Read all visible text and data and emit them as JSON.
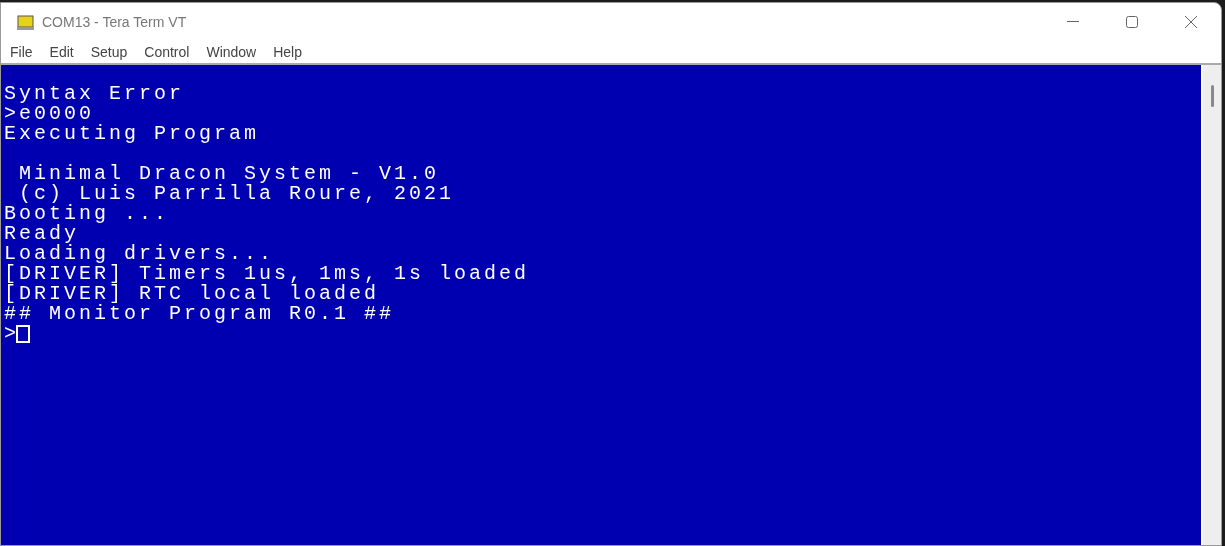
{
  "window": {
    "title": "COM13 - Tera Term VT"
  },
  "menu": [
    "File",
    "Edit",
    "Setup",
    "Control",
    "Window",
    "Help"
  ],
  "terminal": {
    "blocks": [
      [
        "Syntax Error",
        ">e0000",
        "Executing Program"
      ],
      [
        " Minimal Dracon System - V1.0",
        " (c) Luis Parrilla Roure, 2021",
        "Booting ...",
        "Ready",
        "Loading drivers...",
        "[DRIVER] Timers 1us, 1ms, 1s loaded",
        "[DRIVER] RTC local loaded",
        "## Monitor Program R0.1 ##"
      ]
    ],
    "prompt": ">"
  }
}
